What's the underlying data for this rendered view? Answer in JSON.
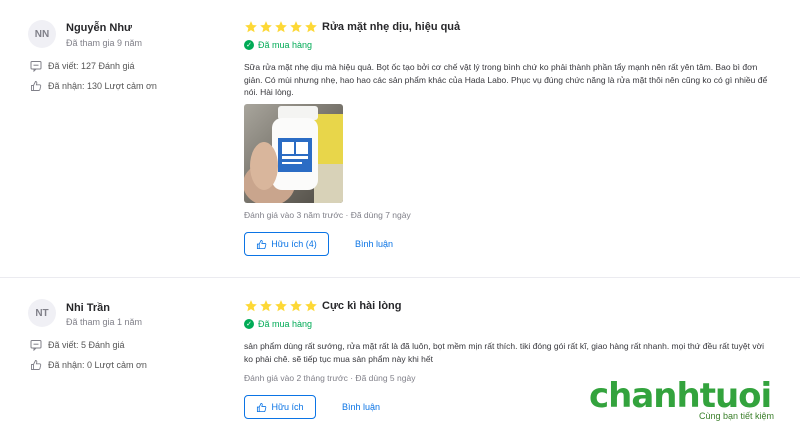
{
  "reviews": [
    {
      "initials": "NN",
      "name": "Nguyễn Như",
      "joined": "Đã tham gia 9 năm",
      "written": "Đã viết: 127 Đánh giá",
      "received": "Đã nhận: 130 Lượt cảm ơn",
      "rating": 5,
      "title": "Rửa mặt nhẹ dịu, hiệu quả",
      "bought": "Đã mua hàng",
      "content": "Sữa rửa mặt nhẹ dịu mà hiệu quả. Bọt ốc tạo bởi cơ chế vật lý trong bình chứ ko phải thành phần tẩy mạnh nên rất yên tâm. Bao bì đơn giản. Có mùi nhưng nhẹ, hao hao các sản phẩm khác của Hada Labo. Phục vụ đúng chức năng là rửa mặt thôi nên cũng ko có gì nhiều để nói. Hài lòng.",
      "meta": "Đánh giá vào 3 năm trước  ·  Đã dùng 7 ngày",
      "helpful": "Hữu ích (4)",
      "reply": "Bình luận"
    },
    {
      "initials": "NT",
      "name": "Nhi Trần",
      "joined": "Đã tham gia 1 năm",
      "written": "Đã viết: 5 Đánh giá",
      "received": "Đã nhận: 0 Lượt cảm ơn",
      "rating": 5,
      "title": "Cực kì hài lòng",
      "bought": "Đã mua hàng",
      "content": "sản phẩm dùng rất sướng, rửa mặt rất là đã luôn, bọt mềm mịn rất thích. tiki đóng gói rất kĩ, giao hàng rất nhanh. mọi thứ đều rất tuyệt vời ko phải chê. sẽ tiếp tục mua sản phẩm này khi hết",
      "meta": "Đánh giá vào 2 tháng trước  ·  Đã dùng 5 ngày",
      "helpful": "Hữu ích",
      "reply": "Bình luận"
    }
  ],
  "logo": {
    "text": "chanhtuoi",
    "tagline": "Cùng bạn tiết kiệm"
  },
  "colors": {
    "star": "#fdd836",
    "accent": "#0b74e5",
    "bought": "#00ab56",
    "logo": "#33a33d"
  }
}
